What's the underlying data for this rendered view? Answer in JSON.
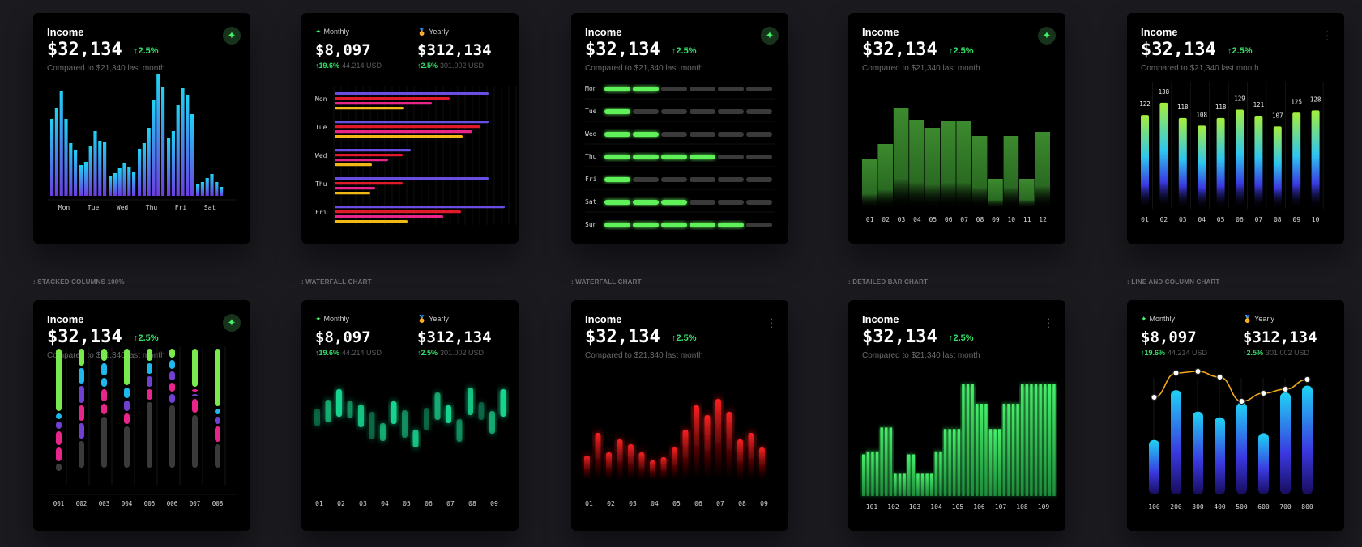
{
  "income": {
    "title": "Income",
    "amount": "$32,134",
    "change": "↑2.5%",
    "compare": "Compared to $21,340 last month"
  },
  "dual": {
    "monthly": {
      "label": "Monthly",
      "amount": "$8,097",
      "change": "↑19.6%",
      "sub": "44.214 USD"
    },
    "yearly": {
      "label": "Yearly",
      "amount": "$312,134",
      "change": "↑2.5%",
      "sub": "301.002 USD"
    }
  },
  "icons": {
    "spark": "✦",
    "medal": "🏅",
    "sparkle_badge": "sparkle-icon",
    "menu": "more-vertical-icon"
  },
  "captions": {
    "c1": ": STACKED COLUMNS 100%",
    "c2": ": WATERFALL CHART",
    "c3": ": WATERFALL CHART",
    "c4": ": DETAILED BAR CHART",
    "c5": ": LINE AND COLUMN CHART"
  },
  "colors": {
    "card": "#000000",
    "accent": "#35e06a",
    "green": "#46f06b",
    "blue": "#1fb8ec",
    "purple": "#6a4ee4",
    "red": "#e0192b",
    "yellow": "#f2b916",
    "pink": "#e8258a",
    "teal": "#17d48d"
  },
  "chart_data": [
    {
      "id": "c0",
      "type": "bar",
      "categories": [
        "Mon",
        "Tue",
        "Wed",
        "Thu",
        "Fri",
        "Sat"
      ],
      "series": [
        {
          "values": [
            95,
            38,
            24,
            58,
            72,
            14
          ]
        },
        {
          "values": [
            108,
            42,
            28,
            65,
            80,
            17
          ]
        },
        {
          "values": [
            130,
            62,
            34,
            84,
            112,
            22
          ]
        },
        {
          "values": [
            95,
            80,
            41,
            118,
            133,
            27
          ]
        },
        {
          "values": [
            65,
            68,
            35,
            150,
            124,
            17
          ]
        },
        {
          "values": [
            57,
            67,
            30,
            135,
            101,
            11
          ]
        }
      ]
    },
    {
      "id": "c1",
      "type": "bar",
      "orientation": "horizontal",
      "categories": [
        "Mon",
        "Tue",
        "Wed",
        "Thu",
        "Fri"
      ],
      "series": [
        {
          "values": [
            95,
            95,
            47,
            95,
            105
          ]
        },
        {
          "values": [
            71,
            90,
            42,
            42,
            78
          ]
        },
        {
          "values": [
            60,
            85,
            33,
            25,
            67
          ]
        },
        {
          "values": [
            43,
            79,
            23,
            22,
            45
          ]
        }
      ]
    },
    {
      "id": "c2",
      "type": "bar",
      "orientation": "horizontal",
      "categories": [
        "Mon",
        "Tue",
        "Wed",
        "Thu",
        "Fri",
        "Sat",
        "Sun"
      ],
      "values": [
        2,
        1,
        2,
        4,
        1,
        3,
        5
      ],
      "max": 6
    },
    {
      "id": "c3",
      "type": "bar",
      "categories": [
        "01",
        "02",
        "03",
        "04",
        "05",
        "06",
        "07",
        "08",
        "09",
        "10",
        "11",
        "12"
      ],
      "values": [
        62,
        80,
        124,
        110,
        100,
        108,
        108,
        90,
        37,
        90,
        37,
        95
      ]
    },
    {
      "id": "c4",
      "type": "bar",
      "categories": [
        "01",
        "02",
        "03",
        "04",
        "05",
        "06",
        "07",
        "08",
        "09",
        "10"
      ],
      "values": [
        122,
        138,
        118,
        108,
        118,
        129,
        121,
        107,
        125,
        128
      ]
    },
    {
      "id": "c5",
      "type": "bar",
      "categories": [
        "001",
        "002",
        "003",
        "004",
        "005",
        "006",
        "007",
        "008"
      ]
    },
    {
      "id": "c6",
      "type": "bar",
      "categories": [
        "01",
        "02",
        "03",
        "04",
        "05",
        "06",
        "07",
        "08",
        "09"
      ],
      "values": [
        60,
        35,
        72,
        52,
        20,
        84,
        60,
        45,
        80
      ]
    },
    {
      "id": "c7",
      "type": "bar",
      "categories": [
        "01",
        "02",
        "03",
        "04",
        "05",
        "06",
        "07",
        "08",
        "09"
      ],
      "values": [
        55,
        42,
        66,
        58,
        88,
        48,
        38,
        54,
        62
      ]
    },
    {
      "id": "c8",
      "type": "bar",
      "categories": [
        "101",
        "102",
        "103",
        "104",
        "105",
        "106",
        "107",
        "108",
        "109"
      ],
      "values": [
        40,
        30,
        55,
        60,
        95,
        100,
        60,
        72,
        110
      ]
    },
    {
      "id": "c9",
      "type": "line",
      "categories": [
        "100",
        "200",
        "300",
        "400",
        "500",
        "600",
        "700",
        "800"
      ],
      "values": [
        48,
        92,
        73,
        68,
        81,
        54,
        90,
        96
      ],
      "line": [
        120,
        150,
        152,
        145,
        115,
        125,
        130,
        142
      ]
    }
  ]
}
